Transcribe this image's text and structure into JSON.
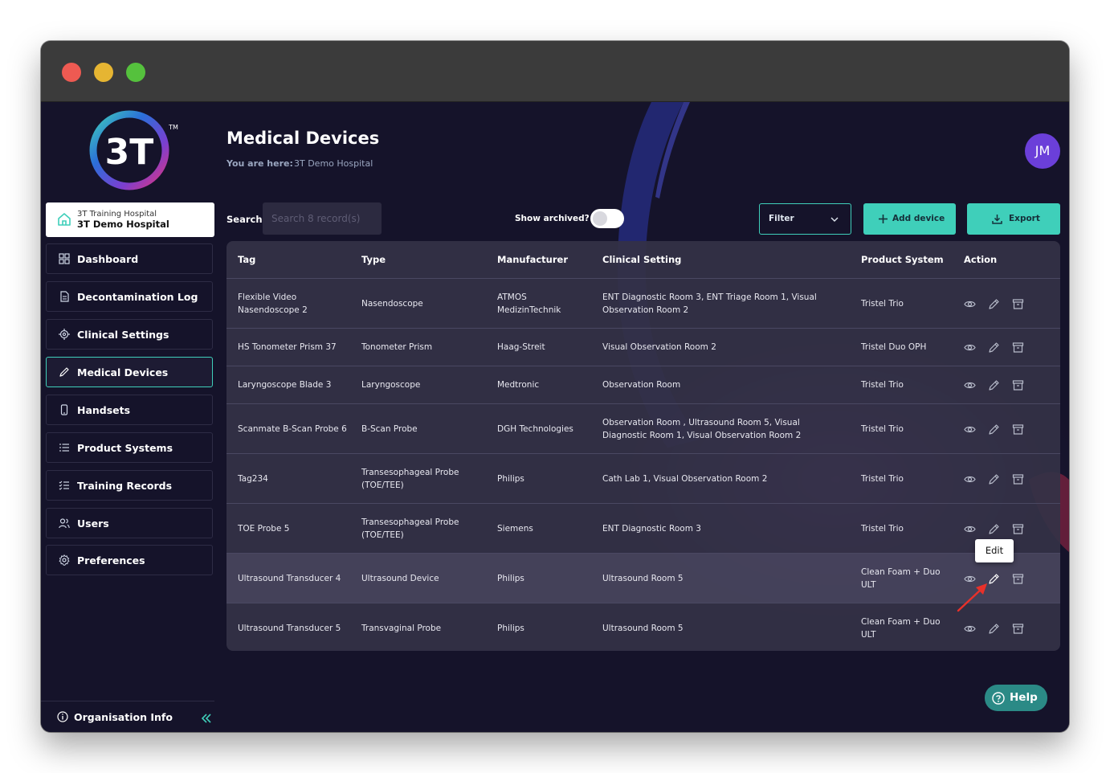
{
  "app": {
    "logo_text": "3T",
    "logo_tm": "TM"
  },
  "sidebar": {
    "hospital_selector": {
      "sub": "3T Training Hospital",
      "name": "3T Demo Hospital"
    },
    "items": [
      {
        "label": "Dashboard",
        "icon": "dashboard-icon",
        "active": false
      },
      {
        "label": "Decontamination Log",
        "icon": "document-icon",
        "active": false
      },
      {
        "label": "Clinical Settings",
        "icon": "target-icon",
        "active": false
      },
      {
        "label": "Medical Devices",
        "icon": "pencil-icon",
        "active": true
      },
      {
        "label": "Handsets",
        "icon": "phone-icon",
        "active": false
      },
      {
        "label": "Product Systems",
        "icon": "list-icon",
        "active": false
      },
      {
        "label": "Training Records",
        "icon": "checklist-icon",
        "active": false
      },
      {
        "label": "Users",
        "icon": "users-icon",
        "active": false
      },
      {
        "label": "Preferences",
        "icon": "gear-icon",
        "active": false
      }
    ],
    "footer": {
      "org_info_label": "Organisation Info"
    }
  },
  "header": {
    "title": "Medical Devices",
    "breadcrumb_label": "You are here:",
    "breadcrumb_value": "3T Demo Hospital",
    "avatar_initials": "JM"
  },
  "toolbar": {
    "search_label": "Search",
    "search_placeholder": "Search 8 record(s)",
    "search_value": "",
    "show_archived_label": "Show archived?",
    "show_archived_on": false,
    "filter_label": "Filter",
    "add_device_label": "Add device",
    "export_label": "Export"
  },
  "table": {
    "columns": [
      "Tag",
      "Type",
      "Manufacturer",
      "Clinical Setting",
      "Product System",
      "Action"
    ],
    "rows": [
      {
        "tag": "Flexible Video Nasendoscope 2",
        "type": "Nasendoscope",
        "manufacturer": "ATMOS MedizinTechnik",
        "clinical_setting": "ENT Diagnostic Room 3, ENT Triage Room 1, Visual Observation Room 2",
        "product_system": "Tristel Trio"
      },
      {
        "tag": "HS Tonometer Prism 37",
        "type": "Tonometer Prism",
        "manufacturer": "Haag-Streit",
        "clinical_setting": "Visual Observation Room 2",
        "product_system": "Tristel Duo OPH"
      },
      {
        "tag": "Laryngoscope Blade 3",
        "type": "Laryngoscope",
        "manufacturer": "Medtronic",
        "clinical_setting": "Observation Room",
        "product_system": "Tristel Trio"
      },
      {
        "tag": "Scanmate B-Scan Probe 6",
        "type": "B-Scan Probe",
        "manufacturer": "DGH Technologies",
        "clinical_setting": "Observation Room , Ultrasound Room 5, Visual Diagnostic Room 1, Visual Observation Room 2",
        "product_system": "Tristel Trio"
      },
      {
        "tag": "Tag234",
        "type": "Transesophageal Probe (TOE/TEE)",
        "manufacturer": "Philips",
        "clinical_setting": "Cath Lab 1, Visual Observation Room 2",
        "product_system": "Tristel Trio"
      },
      {
        "tag": "TOE Probe 5",
        "type": "Transesophageal Probe (TOE/TEE)",
        "manufacturer": "Siemens",
        "clinical_setting": "ENT Diagnostic Room 3",
        "product_system": "Tristel Trio"
      },
      {
        "tag": "Ultrasound Transducer 4",
        "type": "Ultrasound Device",
        "manufacturer": "Philips",
        "clinical_setting": "Ultrasound Room 5",
        "product_system": "Clean Foam + Duo ULT"
      },
      {
        "tag": "Ultrasound Transducer 5",
        "type": "Transvaginal Probe",
        "manufacturer": "Philips",
        "clinical_setting": "Ultrasound Room 5",
        "product_system": "Clean Foam + Duo ULT"
      }
    ],
    "action_icons": [
      "eye-icon",
      "pencil-icon",
      "archive-icon"
    ],
    "hovered_row": 6
  },
  "tooltip": {
    "text": "Edit"
  },
  "help": {
    "label": "Help"
  },
  "colors": {
    "background": "#15132a",
    "accent_teal": "#3fcfba",
    "avatar": "#6b3fd9",
    "help_button": "#2b8a86",
    "annotation_arrow": "#e8312a"
  }
}
